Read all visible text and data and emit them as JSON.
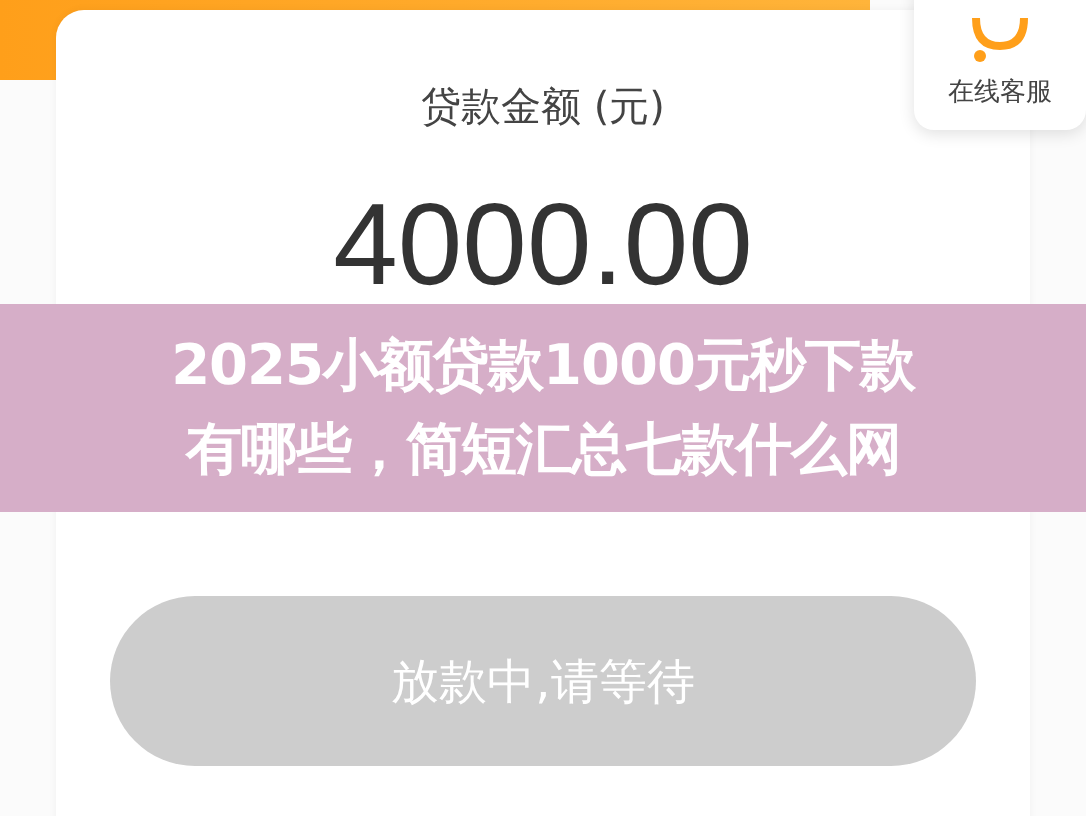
{
  "loan": {
    "label": "贷款金额 (元)",
    "amount": "4000.00"
  },
  "service": {
    "label": "在线客服"
  },
  "banner": {
    "lines": [
      "2025小额贷款1000元秒下款",
      "有哪些，简短汇总七款什么网"
    ]
  },
  "action": {
    "label": "放款中,请等待",
    "disabled": true
  }
}
